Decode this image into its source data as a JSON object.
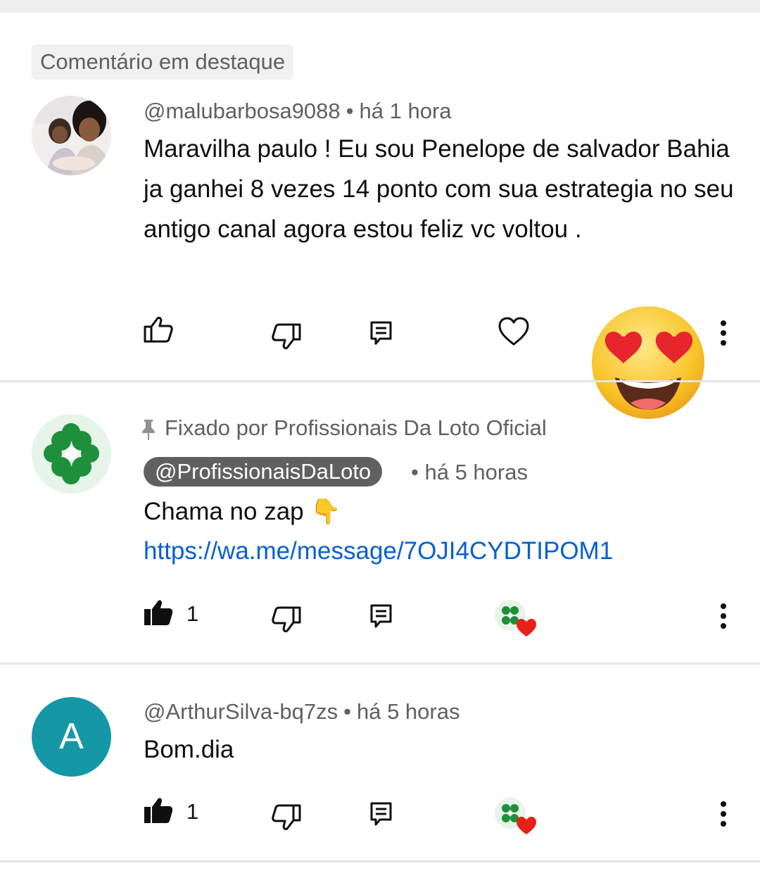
{
  "highlight_label": "Comentário em destaque",
  "comments": [
    {
      "author": "@malubarbosa9088",
      "separator": "•",
      "time": "há 1 hora",
      "text": "Maravilha paulo ! Eu sou Penelope de salvador Bahia ja ganhei 8 vezes 14 ponto com sua estrategia no seu antigo canal agora estou feliz vc voltou .",
      "avatar_icon": "user-photo-avatar",
      "like_icon": "thumb-up-outline-icon",
      "dislike_icon": "thumb-down-outline-icon",
      "reply_icon": "comment-reply-icon",
      "heart_icon": "heart-outline-icon",
      "more_icon": "more-vertical-icon",
      "overlay_emoji": "😍"
    },
    {
      "pinned_text": "Fixado por Profissionais Da Loto Oficial",
      "author": "@ProfissionaisDaLoto",
      "separator": "•",
      "time": "há 5 horas",
      "text": "Chama no zap 👇",
      "link": "https://wa.me/message/7OJI4CYDTIPOM1",
      "like_count": "1",
      "avatar_icon": "clover-channel-avatar",
      "like_icon": "thumb-up-filled-icon",
      "creator_heart_icon": "creator-heart-icon"
    },
    {
      "author": "@ArthurSilva-bq7zs",
      "separator": "•",
      "time": "há 5 horas",
      "text": "Bom.dia",
      "avatar_letter": "A",
      "avatar_color": "#1597a6",
      "like_count": "1",
      "like_icon": "thumb-up-filled-icon",
      "creator_heart_icon": "creator-heart-icon"
    }
  ],
  "colors": {
    "link": "#065fd4",
    "meta": "#606060",
    "chip": "#606060",
    "heart": "#e62117",
    "clover": "#1e8f3a"
  }
}
